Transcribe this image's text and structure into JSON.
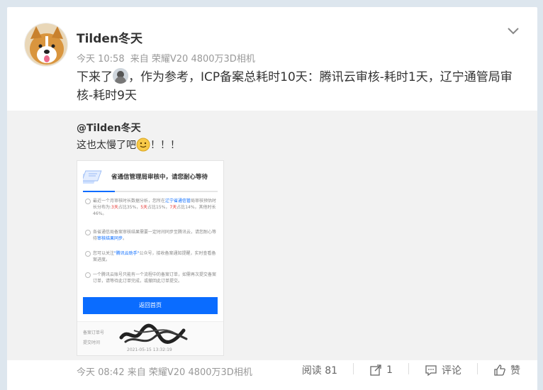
{
  "post": {
    "username": "Tilden冬天",
    "time": "今天 10:58",
    "source": "来自 荣耀V20 4800万3D相机",
    "text_before": "下来了",
    "text_after": "，作为参考，ICP备案总耗时10天：腾讯云审核-耗时1天，辽宁通管局审核-耗时9天"
  },
  "repost": {
    "mention": "@Tilden冬天",
    "text_before": "这也太慢了吧",
    "text_after": "！！！"
  },
  "screenshot": {
    "title": "省通信管理局审核中，请您耐心等待",
    "b1_a": "最近一个月审核时长数据分析，您所在",
    "b1_link": "辽宁省通信管",
    "b1_b": "局审核预估时长分布为:",
    "b1_r1": "3天",
    "b1_c": "占比35%，",
    "b1_r2": "5天",
    "b1_d": "占比15%，",
    "b1_r3": "7天",
    "b1_e": "占比14%，其他时长46%。",
    "b2_a": "各省通信局备案审核结果需要一定时间同步至腾讯云，请您耐心等待",
    "b2_link": "审核结果同步",
    "b2_b": "。",
    "b3_a": "您可以关注",
    "b3_link": "\"腾讯云助手\"",
    "b3_b": "公众号，接收备案通知提醒，实时查看备案进度。",
    "b4": "一个腾讯云账号只能有一个流程中的备案订单，如需再次提交备案订单，请等待此订单完成，或撤回此订单提交。",
    "button": "返回首页",
    "order_label": "备案订单号",
    "submit_label": "提交时间",
    "submit_date": "2021-05-15 13:32:19"
  },
  "footer": {
    "time": "今天 08:42",
    "source": "来自 荣耀V20 4800万3D相机",
    "read": "阅读 81",
    "repost_count": "1",
    "comment": "评论",
    "like": "赞"
  }
}
